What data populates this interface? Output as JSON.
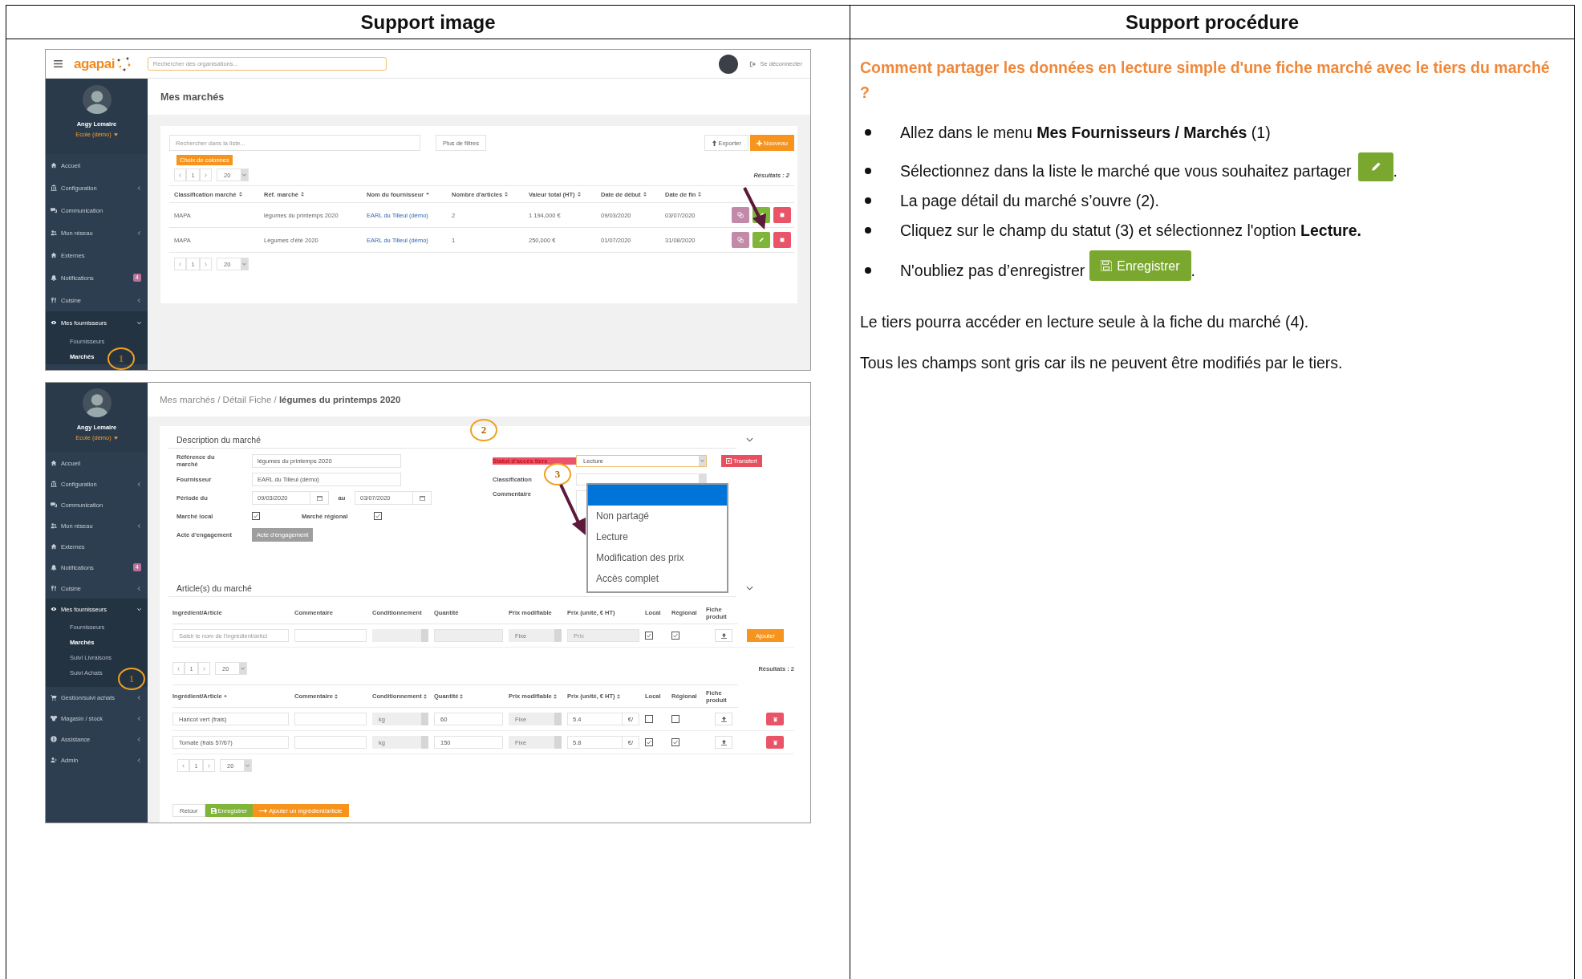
{
  "header": {
    "left": "Support image",
    "right": "Support procédure"
  },
  "screen_1": {
    "app_name": "agapai",
    "org_search_placeholder": "Rechercher des organisations...",
    "logout": "Se déconnecter",
    "user": {
      "name": "Angy Lemaire",
      "org": "Ecole (démo)"
    },
    "sidebar": [
      {
        "label": "Accueil",
        "selected": false
      },
      {
        "label": "Configuration",
        "expanded": false,
        "selected": false
      },
      {
        "label": "Communication",
        "selected": false
      },
      {
        "label": "Mon réseau",
        "expanded": false,
        "selected": false
      },
      {
        "label": "Externes",
        "selected": false
      },
      {
        "label": "Notifications",
        "badge": "4",
        "selected": false
      },
      {
        "label": "Cuisine",
        "expanded": false,
        "selected": false
      },
      {
        "label": "Mes fournisseurs",
        "expanded": true,
        "selected": true,
        "children": [
          {
            "label": "Fournisseurs",
            "selected": false
          },
          {
            "label": "Marchés",
            "selected": true
          }
        ]
      }
    ],
    "callout": "1",
    "page_title": "Mes marchés",
    "list_search_placeholder": "Rechercher dans la liste...",
    "filters_button": "Plus de filtres",
    "export_button": "Exporter",
    "new_button": "Nouveau",
    "columns_button": "Choix de colonnes",
    "pager_top": {
      "page": "1",
      "size": "20"
    },
    "results": "Résultats : 2",
    "columns": [
      {
        "label": "Classification marché",
        "sortable": true,
        "sorted": false,
        "kind": "text"
      },
      {
        "label": "Réf. marché",
        "sortable": true,
        "sorted": false,
        "kind": "text"
      },
      {
        "label": "Nom du fournisseur",
        "sortable": true,
        "sorted": true,
        "kind": "link"
      },
      {
        "label": "Nombre d'articles",
        "sortable": true,
        "sorted": false,
        "kind": "text"
      },
      {
        "label": "Valeur total (HT)",
        "sortable": true,
        "sorted": false,
        "kind": "text"
      },
      {
        "label": "Date de début",
        "sortable": true,
        "sorted": false,
        "kind": "text"
      },
      {
        "label": "Date de fin",
        "sortable": true,
        "sorted": false,
        "kind": "text"
      }
    ],
    "rows": [
      {
        "cells": [
          "MAPA",
          "légumes du printemps 2020",
          "EARL du Tilleul (démo)",
          "2",
          "1 194,000 €",
          "09/03/2020",
          "03/07/2020"
        ]
      },
      {
        "cells": [
          "MAPA",
          "Légumes d'été 2020",
          "EARL du Tilleul (démo)",
          "1",
          "250,000 €",
          "01/07/2020",
          "31/08/2020"
        ]
      }
    ],
    "pager_bottom": {
      "page": "1",
      "size": "20"
    }
  },
  "screen_2": {
    "user": {
      "name": "Angy Lemaire",
      "org": "Ecole (démo)"
    },
    "sidebar": [
      {
        "label": "Accueil",
        "selected": false
      },
      {
        "label": "Configuration",
        "expanded": false,
        "selected": false
      },
      {
        "label": "Communication",
        "selected": false
      },
      {
        "label": "Mon réseau",
        "expanded": false,
        "selected": false
      },
      {
        "label": "Externes",
        "selected": false
      },
      {
        "label": "Notifications",
        "badge": "4",
        "selected": false
      },
      {
        "label": "Cuisine",
        "expanded": false,
        "selected": false
      },
      {
        "label": "Mes fournisseurs",
        "expanded": true,
        "selected": true,
        "children": [
          {
            "label": "Fournisseurs",
            "selected": false
          },
          {
            "label": "Marchés",
            "selected": true
          },
          {
            "label": "Suivi Livraisons",
            "selected": false
          },
          {
            "label": "Suivi Achats",
            "selected": false
          }
        ]
      },
      {
        "label": "Gestion/suivi achats",
        "expanded": false,
        "selected": false
      },
      {
        "label": "Magasin / stock",
        "expanded": false,
        "selected": false
      },
      {
        "label": "Assistance",
        "expanded": false,
        "selected": false
      },
      {
        "label": "Admin",
        "expanded": false,
        "selected": false
      }
    ],
    "callout": "1",
    "breadcrumb": "Mes marchés / Détail Fiche / **légumes du printemps 2020**",
    "description": {
      "title": "Description du marché",
      "callout": "2",
      "reference": {
        "label": "Référence du marché",
        "value": "légumes du printemps 2020"
      },
      "supplier": {
        "label": "Fournisseur",
        "value": "EARL du Tilleul (démo)"
      },
      "period": {
        "label": "Période du",
        "from": "09/03/2020",
        "to_label": "au",
        "to": "03/07/2020"
      },
      "local": {
        "label": "Marché local",
        "checked": true
      },
      "regional": {
        "label": "Marché régional",
        "checked": true
      },
      "commitment": {
        "label": "Acte d'engagement",
        "button": "Acte d'engagement",
        "disabled": true
      },
      "access": {
        "label": "Statut d'accès tiers",
        "value": "Lecture",
        "callout": "3",
        "options": [
          "Non partagé",
          "Lecture",
          "Modification des prix",
          "Accès complet"
        ]
      },
      "transfer_button": "Transfert",
      "classification_label": "Classification",
      "comment_label": "Commentaire"
    },
    "articles": {
      "title": "Article(s) du marché",
      "add_columns": [
        {
          "label": "Ingrédient/Article"
        },
        {
          "label": "Commentaire"
        },
        {
          "label": "Conditionnement"
        },
        {
          "label": "Quantité"
        },
        {
          "label": "Prix modifiable"
        },
        {
          "label": "Prix (unité, € HT)"
        },
        {
          "label": "Local"
        },
        {
          "label": "Régional"
        },
        {
          "label": "Fiche produit"
        }
      ],
      "add_row": {
        "article_placeholder": "Saisir le nom de l'ingrédient/articl",
        "price_mode": "Fixe",
        "price_placeholder": "Prix",
        "local": true,
        "regional": true,
        "add_button": "Ajouter"
      },
      "pager_top": {
        "page": "1",
        "size": "20"
      },
      "results": "Résultats : 2",
      "columns": [
        {
          "label": "Ingrédient/Article",
          "sortable": true,
          "sorted": true
        },
        {
          "label": "Commentaire",
          "sortable": true,
          "sorted": false
        },
        {
          "label": "Conditionnement",
          "sortable": true,
          "sorted": false
        },
        {
          "label": "Quantité",
          "sortable": true,
          "sorted": false
        },
        {
          "label": "Prix modifiable",
          "sortable": true,
          "sorted": false
        },
        {
          "label": "Prix (unité, € HT)",
          "sortable": true,
          "sorted": false
        },
        {
          "label": "Local",
          "sortable": false,
          "sorted": false
        },
        {
          "label": "Régional",
          "sortable": false,
          "sorted": false
        },
        {
          "label": "Fiche produit",
          "sortable": false,
          "sorted": false
        }
      ],
      "rows": [
        {
          "article": "Haricot vert (frais)",
          "unit": "kg",
          "quantity": "60",
          "price_mode": "Fixe",
          "price": "5.4",
          "currency": "€/",
          "local": false,
          "regional": false
        },
        {
          "article": "Tomate (frais  57/67)",
          "unit": "kg",
          "quantity": "150",
          "price_mode": "Fixe",
          "price": "5.8",
          "currency": "€/",
          "local": true,
          "regional": true
        }
      ],
      "pager_bottom": {
        "page": "1",
        "size": "20"
      }
    },
    "footer": {
      "back": "Retour",
      "save": "Enregistrer",
      "add": "Ajouter un ingrédient/article"
    }
  },
  "procedure": {
    "title": "Comment partager les données en lecture simple d'une fiche marché avec le tiers du marché ?",
    "steps": [
      {
        "text": "Allez dans le menu **Mes Fournisseurs / Marchés** (1)"
      },
      {
        "text": "Sélectionnez dans la liste le marché que vous souhaitez partager",
        "button": {
          "kind": "edit"
        },
        "tail": "."
      },
      {
        "text": "La page détail du marché s’ouvre (2)."
      },
      {
        "text": "Cliquez sur le champ du statut (3) et sélectionnez l'option **Lecture.**"
      },
      {
        "text": "N'oubliez pas d’enregistrer",
        "button": {
          "kind": "save",
          "label": "Enregistrer"
        },
        "tail": "."
      }
    ],
    "paragraphs": [
      "Le tiers pourra accéder en lecture seule à la fiche du marché (4).",
      "Tous les champs sont gris car ils ne peuvent être modifiés par le tiers."
    ]
  }
}
